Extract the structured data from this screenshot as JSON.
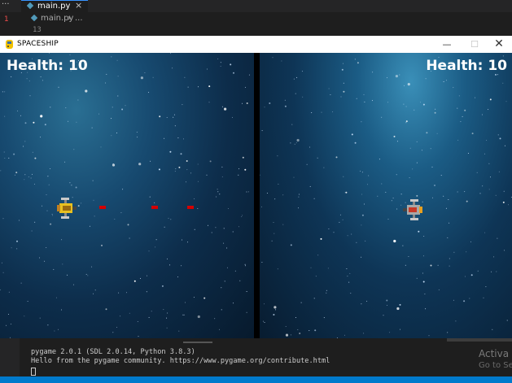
{
  "editor": {
    "overflow_dots": "···",
    "tab": {
      "label": "main.py",
      "close": "×"
    },
    "gutter_mark": "1",
    "breadcrumb": {
      "file": "main.py",
      "separator": "›",
      "rest": "..."
    },
    "line_number": "13"
  },
  "game_window": {
    "title": "SPACESHIP",
    "controls": {
      "minimize": "—",
      "maximize": "☐",
      "close": "✕"
    },
    "left_player": {
      "health_text": "Health: 10"
    },
    "right_player": {
      "health_text": "Health: 10"
    },
    "colors": {
      "yellow_ship": "#e8c020",
      "red_ship": "#c83a28",
      "bullet": "#d40000",
      "divider": "#000000"
    }
  },
  "terminal": {
    "lines": [
      "pygame 2.0.1 (SDL 2.0.14, Python 3.8.3)",
      "Hello from the pygame community. https://www.pygame.org/contribute.html"
    ],
    "watermark_line1": "Activa",
    "watermark_line2": "Go to Se"
  },
  "statusbar": {
    "color": "#007acc"
  }
}
